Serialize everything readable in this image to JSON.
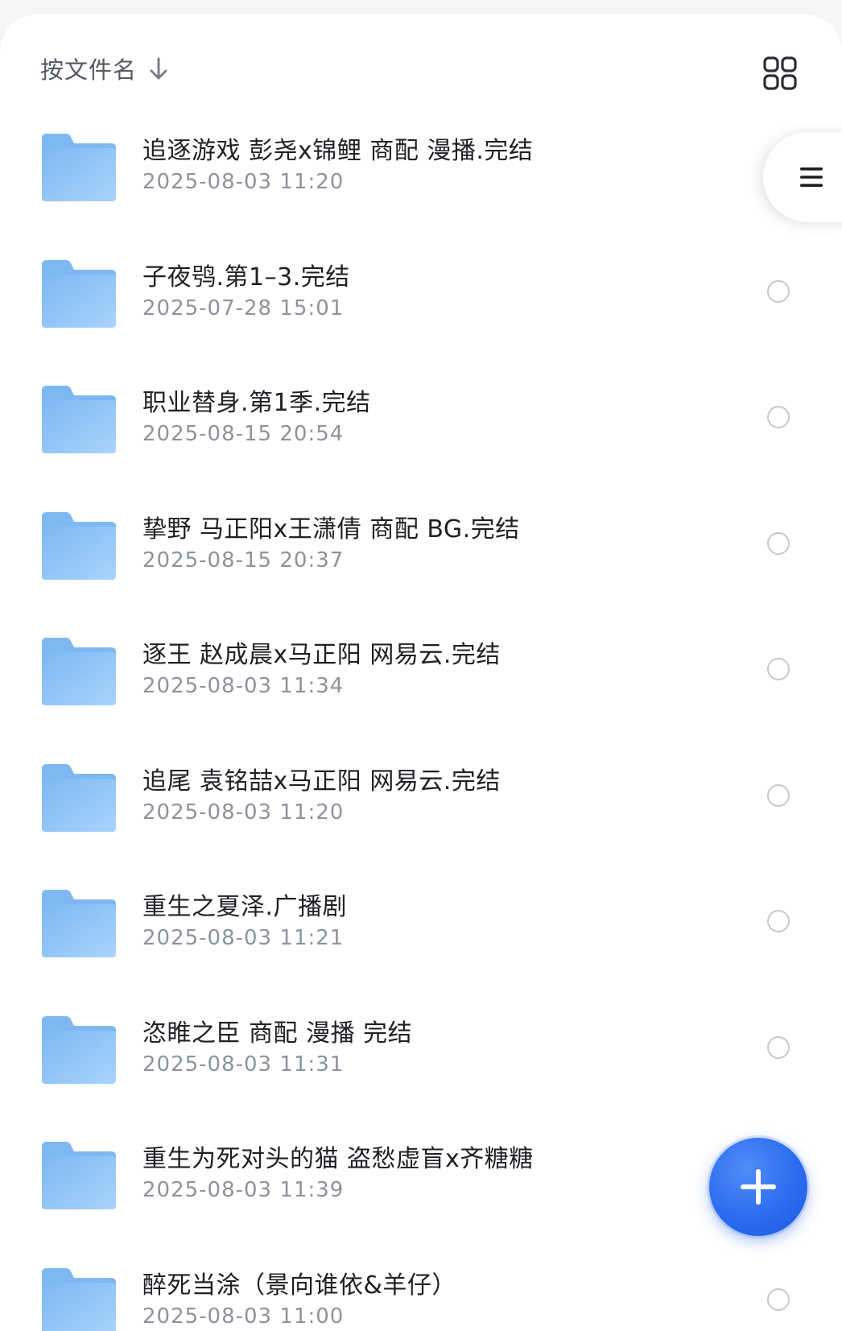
{
  "toolbar": {
    "sort_label": "按文件名",
    "sort_icon": "arrow-down-icon",
    "view_toggle_icon": "grid-view-icon"
  },
  "files": [
    {
      "name": "追逐游戏 彭尧x锦鲤 商配 漫播.完结",
      "date": "2025-08-03 11:20",
      "type": "folder"
    },
    {
      "name": "子夜鸮.第1–3.完结",
      "date": "2025-07-28 15:01",
      "type": "folder"
    },
    {
      "name": "职业替身.第1季.完结",
      "date": "2025-08-15 20:54",
      "type": "folder"
    },
    {
      "name": "挚野 马正阳x王潇倩 商配 BG.完结",
      "date": "2025-08-15 20:37",
      "type": "folder"
    },
    {
      "name": "逐王 赵成晨x马正阳 网易云.完结",
      "date": "2025-08-03 11:34",
      "type": "folder"
    },
    {
      "name": "追尾 袁铭喆x马正阳 网易云.完结",
      "date": "2025-08-03 11:20",
      "type": "folder"
    },
    {
      "name": "重生之夏泽.广播剧",
      "date": "2025-08-03 11:21",
      "type": "folder"
    },
    {
      "name": "恣睢之臣 商配 漫播 完结",
      "date": "2025-08-03 11:31",
      "type": "folder"
    },
    {
      "name": "重生为死对头的猫 盗愁虚盲x齐糖糖",
      "date": "2025-08-03 11:39",
      "type": "folder"
    },
    {
      "name": "醉死当涂（景向谁依&羊仔）",
      "date": "2025-08-03 11:00",
      "type": "folder"
    }
  ],
  "side_menu": {
    "icon": "hamburger-menu-icon"
  },
  "fab": {
    "icon": "plus-icon"
  },
  "colors": {
    "folder_light": "#a9d3fb",
    "folder_dark": "#7db8f3",
    "accent": "#2c6cf0",
    "text_primary": "#1e2024",
    "text_secondary": "#8e939b"
  }
}
